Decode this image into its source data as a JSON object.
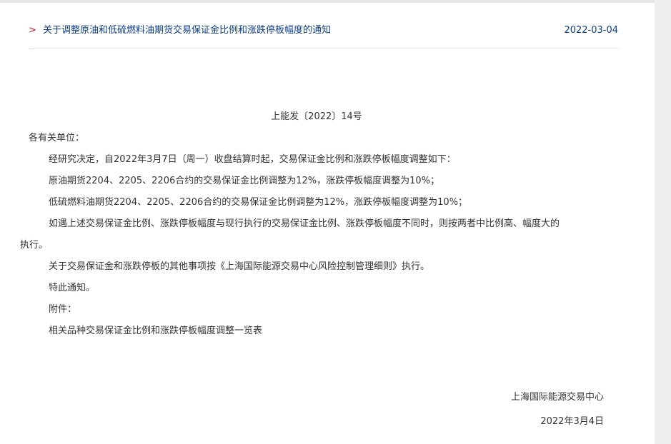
{
  "header": {
    "chevron": ">",
    "title": "关于调整原油和低硫燃料油期货交易保证金比例和涨跌停板幅度的通知",
    "date": "2022-03-04"
  },
  "doc": {
    "number": "上能发〔2022〕14号",
    "salutation": "各有关单位：",
    "paragraphs": [
      "经研究决定，自2022年3月7日（周一）收盘结算时起，交易保证金比例和涨跌停板幅度调整如下：",
      "原油期货2204、2205、2206合约的交易保证金比例调整为12%，涨跌停板幅度调整为10%；",
      "低硫燃料油期货2204、2205、2206合约的交易保证金比例调整为12%，涨跌停板幅度调整为10%；",
      "如遇上述交易保证金比例、涨跌停板幅度与现行执行的交易保证金比例、涨跌停板幅度不同时，则按两者中比例高、幅度大的",
      "执行。",
      "关于交易保证金和涨跌停板的其他事项按《上海国际能源交易中心风险控制管理细则》执行。",
      "特此通知。",
      "附件：",
      "相关品种交易保证金比例和涨跌停板幅度调整一览表"
    ],
    "signature_org": "上海国际能源交易中心",
    "signature_date": "2022年3月4日"
  }
}
